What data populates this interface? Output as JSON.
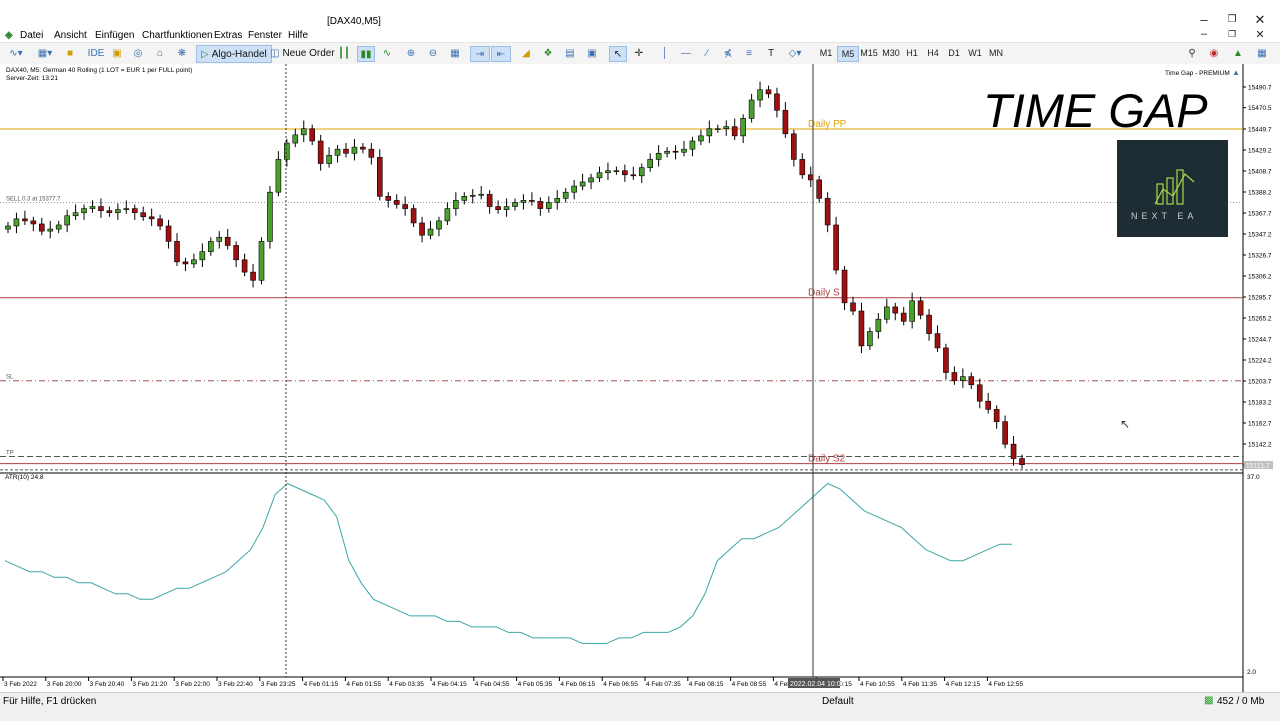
{
  "window": {
    "title": "[DAX40,M5]"
  },
  "menu": [
    "Datei",
    "Ansicht",
    "Einfügen",
    "Chartfunktionen",
    "Extras",
    "Fenster",
    "Hilfe"
  ],
  "toolbar": {
    "algo_label": "Algo-Handel",
    "order_label": "Neue Order",
    "ide_label": "IDE",
    "timeframes": [
      "M1",
      "M5",
      "M15",
      "M30",
      "H1",
      "H4",
      "D1",
      "W1",
      "MN"
    ],
    "active_timeframe": "M5"
  },
  "chart": {
    "header_line1": "DAX40, M5:  German 40 Rolling (1 LOT = EUR 1 per FULL point)",
    "header_line2": "Server-Zeit: 13:21",
    "indicator_name": "Time Gap - PREMIUM",
    "overlay_title": "TIME GAP",
    "logo_text": "NEXT EA",
    "level_sell_label": "SELL 0.3 at 15377.7",
    "level_sl_label": "SL",
    "level_tp_label": "TP",
    "daily_pp_label": "Daily PP",
    "daily_s1_label": "Daily S",
    "daily_s2_label": "Daily S2",
    "price_ticks": [
      "15490.7",
      "15470.5",
      "15449.7",
      "15429.2",
      "15408.7",
      "15388.2",
      "15367.7",
      "15347.2",
      "15326.7",
      "15306.2",
      "15285.7",
      "15265.2",
      "15244.7",
      "15224.2",
      "15203.7",
      "15183.2",
      "15162.7",
      "15142.2",
      "15121.7"
    ],
    "current_price": "15121.7",
    "atr_label": "ATR(10) 24.8",
    "atr_ticks": [
      "37.0",
      "2.0"
    ],
    "time_ticks": [
      "3 Feb 2022",
      "3 Feb 20:00",
      "3 Feb 20:40",
      "3 Feb 21:20",
      "3 Feb 22:00",
      "3 Feb 22:40",
      "3 Feb 23:25",
      "4 Feb 01:15",
      "4 Feb 01:55",
      "4 Feb 03:35",
      "4 Feb 04:15",
      "4 Feb 04:55",
      "4 Feb 05:35",
      "4 Feb 06:15",
      "4 Feb 06:55",
      "4 Feb 07:35",
      "4 Feb 08:15",
      "4 Feb 08:55",
      "4 Feb 09:35",
      "4 Feb 10:15",
      "4 Feb 10:55",
      "4 Feb 11:35",
      "4 Feb 12:15",
      "4 Feb 12:55"
    ],
    "crosshair_time": "2022.02.04 10:05",
    "colors": {
      "bull": "#4aa02c",
      "bear": "#a01010",
      "pp": "#e2a400",
      "s1": "#b04040",
      "atr": "#3aa6a6"
    }
  },
  "chart_data": {
    "type": "candlestick",
    "closes": [
      15355,
      15362,
      15360,
      15357,
      15350,
      15352,
      15356,
      15365,
      15368,
      15372,
      15374,
      15370,
      15368,
      15371,
      15372,
      15368,
      15364,
      15362,
      15355,
      15340,
      15320,
      15318,
      15322,
      15330,
      15340,
      15344,
      15336,
      15322,
      15310,
      15302,
      15340,
      15388,
      15420,
      15436,
      15444,
      15450,
      15438,
      15416,
      15424,
      15430,
      15426,
      15432,
      15430,
      15422,
      15384,
      15380,
      15376,
      15372,
      15358,
      15346,
      15352,
      15360,
      15372,
      15380,
      15384,
      15385,
      15386,
      15374,
      15371,
      15374,
      15378,
      15380,
      15379,
      15372,
      15378,
      15382,
      15388,
      15394,
      15398,
      15402,
      15407,
      15409,
      15409,
      15405,
      15404,
      15412,
      15420,
      15426,
      15428,
      15427,
      15430,
      15438,
      15443,
      15450,
      15450,
      15452,
      15443,
      15460,
      15478,
      15488,
      15484,
      15468,
      15445,
      15420,
      15405,
      15400,
      15382,
      15356,
      15312,
      15280,
      15272,
      15238,
      15252,
      15264,
      15276,
      15270,
      15262,
      15282,
      15268,
      15250,
      15236,
      15212,
      15204,
      15208,
      15200,
      15184,
      15176,
      15164,
      15142,
      15128,
      15122
    ]
  },
  "status": {
    "left": "Für Hilfe, F1 drücken",
    "profile": "Default",
    "traffic": "452 / 0 Mb"
  }
}
